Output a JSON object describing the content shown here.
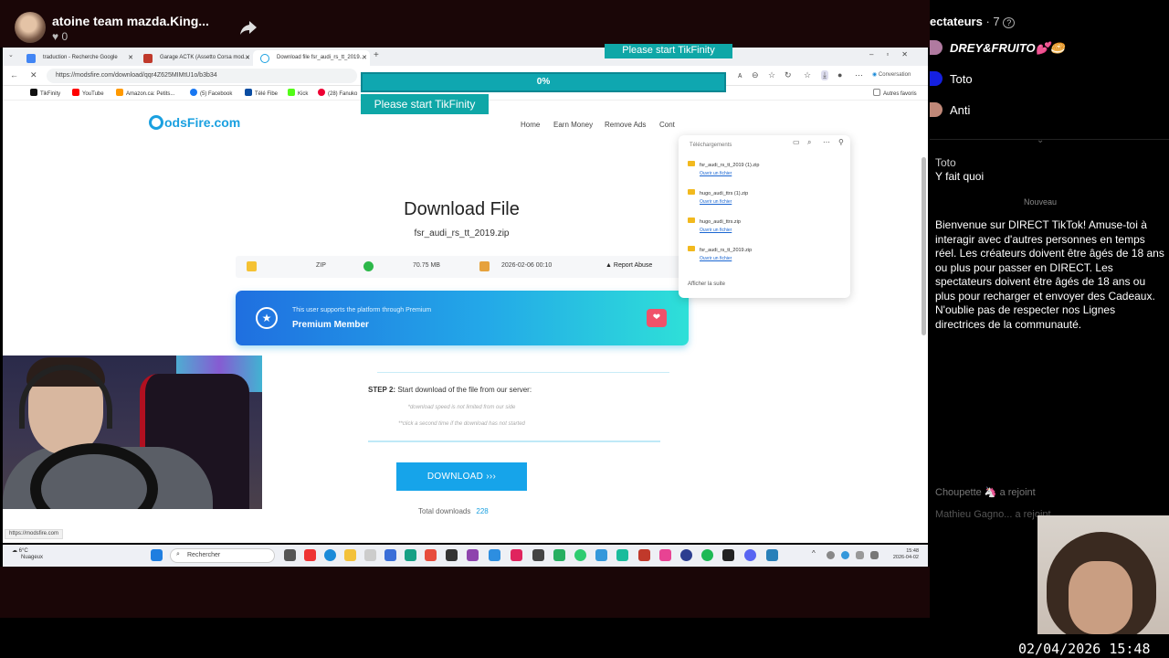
{
  "stream": {
    "host_name": "atoine team mazda.King...",
    "likes": "0"
  },
  "browser": {
    "tabs": [
      {
        "label": "traduction - Recherche Google",
        "fav_color": "#4285f4"
      },
      {
        "label": "Garage ACTK (Assetto Corsa mod...",
        "fav_color": "#c0392b"
      },
      {
        "label": "Download file fsr_audi_rs_tt_2019...",
        "fav_color": "#1aa0e0"
      }
    ],
    "url": "https://modsfire.com/download/qqr4Z625MIMtU1o/b3b34",
    "copilot_label": "Conversation",
    "bookmarks": [
      {
        "label": "TikFinity",
        "color": "#111"
      },
      {
        "label": "YouTube",
        "color": "#ff0000"
      },
      {
        "label": "Amazon.ca: Petits...",
        "color": "#f90"
      },
      {
        "label": "(5) Facebook",
        "color": "#1877f2"
      },
      {
        "label": "Télé Fibe",
        "color": "#0a4da2"
      },
      {
        "label": "Kick",
        "color": "#53fc18"
      },
      {
        "label": "(28) Fanuko",
        "color": "#e03"
      }
    ],
    "other_bookmarks": "Autres favoris",
    "status_url": "https://modsfire.com"
  },
  "site": {
    "logo": "odsFire.com",
    "nav": [
      "Home",
      "Earn Money",
      "Remove Ads",
      "Cont"
    ],
    "title": "Download File",
    "file_name": "fsr_audi_rs_tt_2019.zip",
    "info": {
      "type": "ZIP",
      "size": "70.75 MB",
      "date": "2026-02-06 00:10",
      "report": "Report Abuse"
    },
    "premium_sub": "This user supports the platform through Premium",
    "premium_main": "Premium Member",
    "step_label": "STEP 2:",
    "step_text": "Start download of the file from our server:",
    "note1": "*download speed is not limited from our side",
    "note2": "**click a second time if the download has not started",
    "download_button": "DOWNLOAD",
    "total_label": "Total downloads",
    "total_value": "228"
  },
  "downloads_panel": {
    "title": "Téléchargements",
    "items": [
      {
        "name": "fsr_audi_rs_tt_2019 (1).zip",
        "action": "Ouvrir un fichier"
      },
      {
        "name": "hugo_audi_ttrs (1).zip",
        "action": "Ouvrir un fichier"
      },
      {
        "name": "hugo_audi_ttrs.zip",
        "action": "Ouvrir un fichier"
      },
      {
        "name": "fsr_audi_rs_tt_2019.zip",
        "action": "Ouvrir un fichier"
      }
    ],
    "more": "Afficher la suite"
  },
  "tikfinity": {
    "banner_text": "Please start TikFinity",
    "progress_label": "0%",
    "progress": 0
  },
  "taskbar": {
    "weather_temp": "6°C",
    "weather_desc": "Nuageux",
    "search_placeholder": "Rechercher",
    "time": "15:48",
    "date": "2026-04-02"
  },
  "panel": {
    "viewers_label": "ectateurs",
    "viewers_count": "· 7",
    "viewers": [
      {
        "name": "DREY&FRUITO💕🥯",
        "color": "#b07aa0"
      },
      {
        "name": "Toto",
        "color": "#1520e0"
      },
      {
        "name": "Anti",
        "color": "#c08878"
      }
    ],
    "chat_user": "Toto",
    "chat_message": "Y fait quoi",
    "new_label": "Nouveau",
    "welcome": "Bienvenue sur DIRECT TikTok! Amuse-toi à interagir avec d'autres personnes en temps réel. Les créateurs doivent être âgés de 18 ans ou plus pour passer en DIRECT. Les spectateurs doivent être âgés de 18 ans ou plus pour recharger et envoyer des Cadeaux. N'oublie pas de respecter nos Lignes directrices de la communauté.",
    "join1": "Choupette 🦄 a rejoint",
    "join2": "Mathieu Gagno... a rejoint",
    "datetime": "02/04/2026 15:48"
  }
}
